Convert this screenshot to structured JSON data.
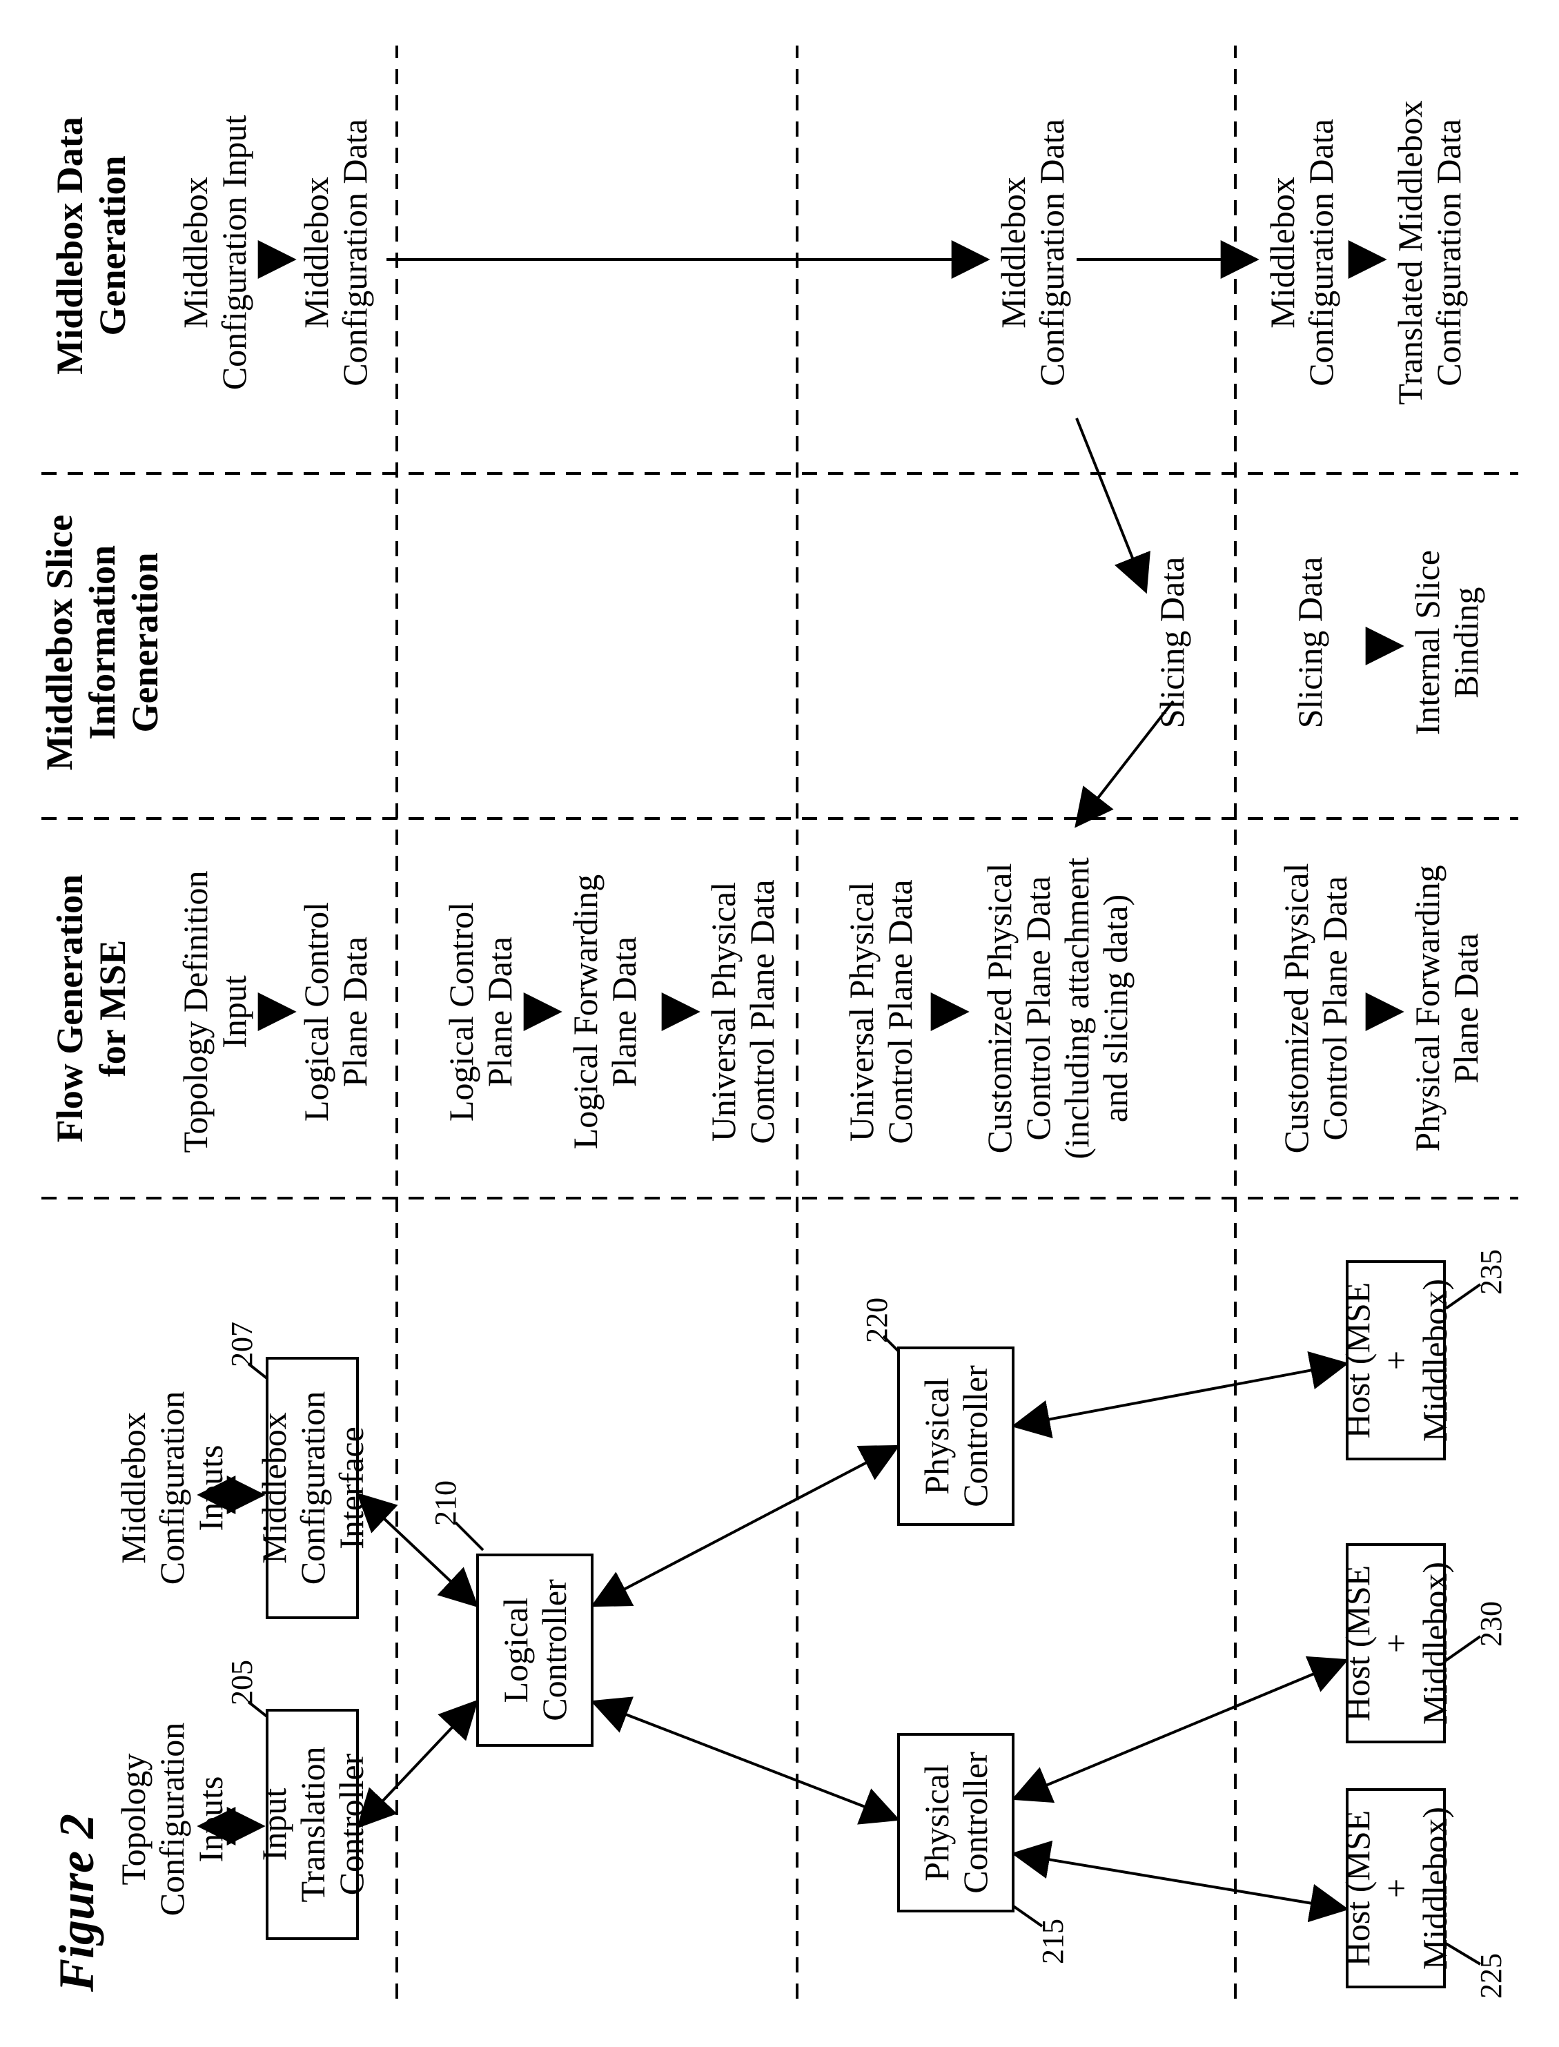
{
  "figure_title": "Figure 2",
  "labels": {
    "topology_inputs": "Topology\nConfiguration Inputs",
    "middlebox_inputs": "Middlebox\nConfiguration Inputs"
  },
  "nodes": {
    "input_translation_controller": "Input Translation\nController",
    "middlebox_config_interface": "Middlebox\nConfiguration Interface",
    "logical_controller": "Logical\nController",
    "physical_controller_a": "Physical\nController",
    "physical_controller_b": "Physical\nController",
    "host_a": "Host (MSE +\nMiddlebox)",
    "host_b": "Host (MSE +\nMiddlebox)",
    "host_c": "Host (MSE +\nMiddlebox)"
  },
  "refs": {
    "input_translation_controller": "205",
    "middlebox_config_interface": "207",
    "logical_controller": "210",
    "physical_controller_a": "215",
    "physical_controller_b": "220",
    "host_a": "225",
    "host_b": "230",
    "host_c": "235"
  },
  "col_heads": {
    "col1": "Flow Generation\nfor MSE",
    "col2": "Middlebox Slice\nInformation\nGeneration",
    "col3": "Middlebox Data\nGeneration"
  },
  "col1": {
    "r1a": "Topology Definition\nInput",
    "r1b": "Logical Control\nPlane Data",
    "r2a": "Logical Control\nPlane Data",
    "r2b": "Logical Forwarding\nPlane Data",
    "r2c": "Universal Physical\nControl Plane Data",
    "r3a": "Universal Physical\nControl Plane Data",
    "r3b": "Customized Physical\nControl Plane Data\n(including attachment\nand slicing data)",
    "r4a": "Customized Physical\nControl Plane Data",
    "r4b": "Physical Forwarding\nPlane Data"
  },
  "col2": {
    "r3a": "Slicing Data",
    "r4a": "Slicing Data",
    "r4b": "Internal Slice\nBinding"
  },
  "col3": {
    "r1a": "Middlebox\nConfiguration Input",
    "r1b": "Middlebox\nConfiguration Data",
    "r3a": "Middlebox\nConfiguration Data",
    "r4a": "Middlebox\nConfiguration Data",
    "r4b": "Translated Middlebox\nConfiguration Data"
  }
}
